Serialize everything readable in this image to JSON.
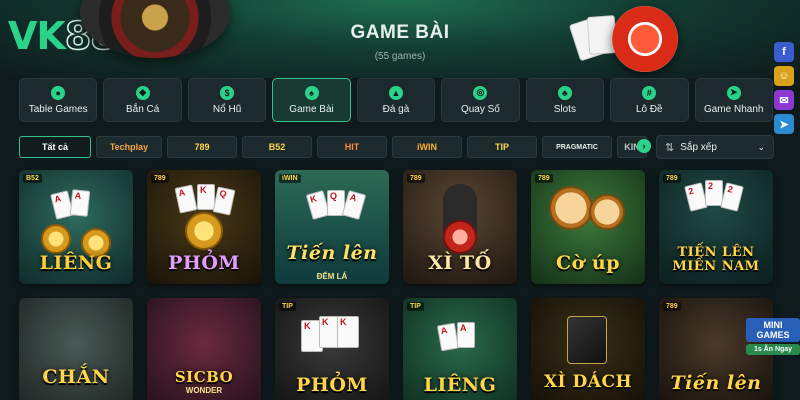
{
  "header": {
    "logo_text": "VK",
    "logo_num": "88",
    "title": "GAME BÀI",
    "count": "(55 games)"
  },
  "categories": [
    {
      "label": "Table Games",
      "icon": "chips-icon",
      "active": false
    },
    {
      "label": "Bắn Cá",
      "icon": "fish-icon",
      "active": false
    },
    {
      "label": "Nổ Hũ",
      "icon": "jackpot-icon",
      "active": false
    },
    {
      "label": "Game Bài",
      "icon": "cards-icon",
      "active": true
    },
    {
      "label": "Đá gà",
      "icon": "rooster-icon",
      "active": false
    },
    {
      "label": "Quay Số",
      "icon": "lottery-ball-icon",
      "active": false
    },
    {
      "label": "Slots",
      "icon": "cherry-icon",
      "active": false
    },
    {
      "label": "Lô Đề",
      "icon": "number-icon",
      "active": false
    },
    {
      "label": "Game Nhanh",
      "icon": "rocket-icon",
      "active": false
    }
  ],
  "providers": [
    {
      "label": "Tất cả",
      "active": true
    },
    {
      "label": "Techplay"
    },
    {
      "label": "789"
    },
    {
      "label": "B52"
    },
    {
      "label": "HIT"
    },
    {
      "label": "iWIN"
    },
    {
      "label": "TIP"
    },
    {
      "label": "PRAGMATIC"
    },
    {
      "label": "KIN"
    }
  ],
  "sort": {
    "label": "Sắp xếp"
  },
  "games": [
    {
      "name": "LIÊNG",
      "badge": "B52",
      "sub": ""
    },
    {
      "name": "PHỎM",
      "badge": "789",
      "sub": ""
    },
    {
      "name": "Tiến lên",
      "badge": "iWIN",
      "sub": "ĐẾM LÁ"
    },
    {
      "name": "XÌ TỐ",
      "badge": "789",
      "sub": ""
    },
    {
      "name": "Cờ úp",
      "badge": "789",
      "sub": ""
    },
    {
      "name": "TIẾN LÊN MIỀN NAM",
      "badge": "789",
      "sub": ""
    },
    {
      "name": "CHẮN",
      "badge": "",
      "sub": ""
    },
    {
      "name": "SICBO",
      "badge": "",
      "sub": "WONDER"
    },
    {
      "name": "PHỎM",
      "badge": "TIP",
      "sub": ""
    },
    {
      "name": "LIÊNG",
      "badge": "TIP",
      "sub": ""
    },
    {
      "name": "XÌ DÁCH",
      "badge": "",
      "sub": ""
    },
    {
      "name": "Tiến lên",
      "badge": "789",
      "sub": ""
    }
  ],
  "promo": {
    "title": "MINI GAMES",
    "subtitle": "1s Ăn Ngay"
  },
  "side_icons": [
    "facebook-icon",
    "support-icon",
    "messenger-icon",
    "telegram-icon"
  ],
  "colors": {
    "accent": "#2ad38a",
    "background": "#0f1a1c",
    "tile": "#1d2a2d"
  }
}
